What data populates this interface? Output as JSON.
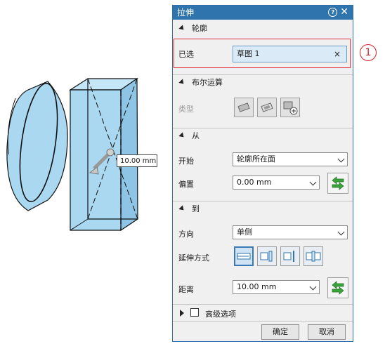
{
  "viewport": {
    "dimension_value": "10.00 mm"
  },
  "dialog": {
    "title": "拉伸",
    "profile": {
      "header": "轮廓",
      "selected_label": "已选",
      "selected_value": "草图 1",
      "clear_symbol": "×"
    },
    "boolean": {
      "header": "布尔运算",
      "type_label": "类型"
    },
    "from": {
      "header": "从",
      "start_label": "开始",
      "start_value": "轮廓所在面",
      "offset_label": "偏置",
      "offset_value": "0.00 mm"
    },
    "to": {
      "header": "到",
      "direction_label": "方向",
      "direction_value": "单侧",
      "extend_label": "延伸方式",
      "distance_label": "距离",
      "distance_value": "10.00 mm"
    },
    "advanced": {
      "label": "高级选项"
    },
    "buttons": {
      "ok": "确定",
      "cancel": "取消"
    }
  },
  "callout": {
    "number": "1"
  },
  "colors": {
    "title_bar": "#2f74ad",
    "highlight": "#e0303a",
    "field_selected": "#dbeaf7",
    "flip_arrow": "#3aa53a",
    "solid_fill": "#a9d8f0"
  }
}
